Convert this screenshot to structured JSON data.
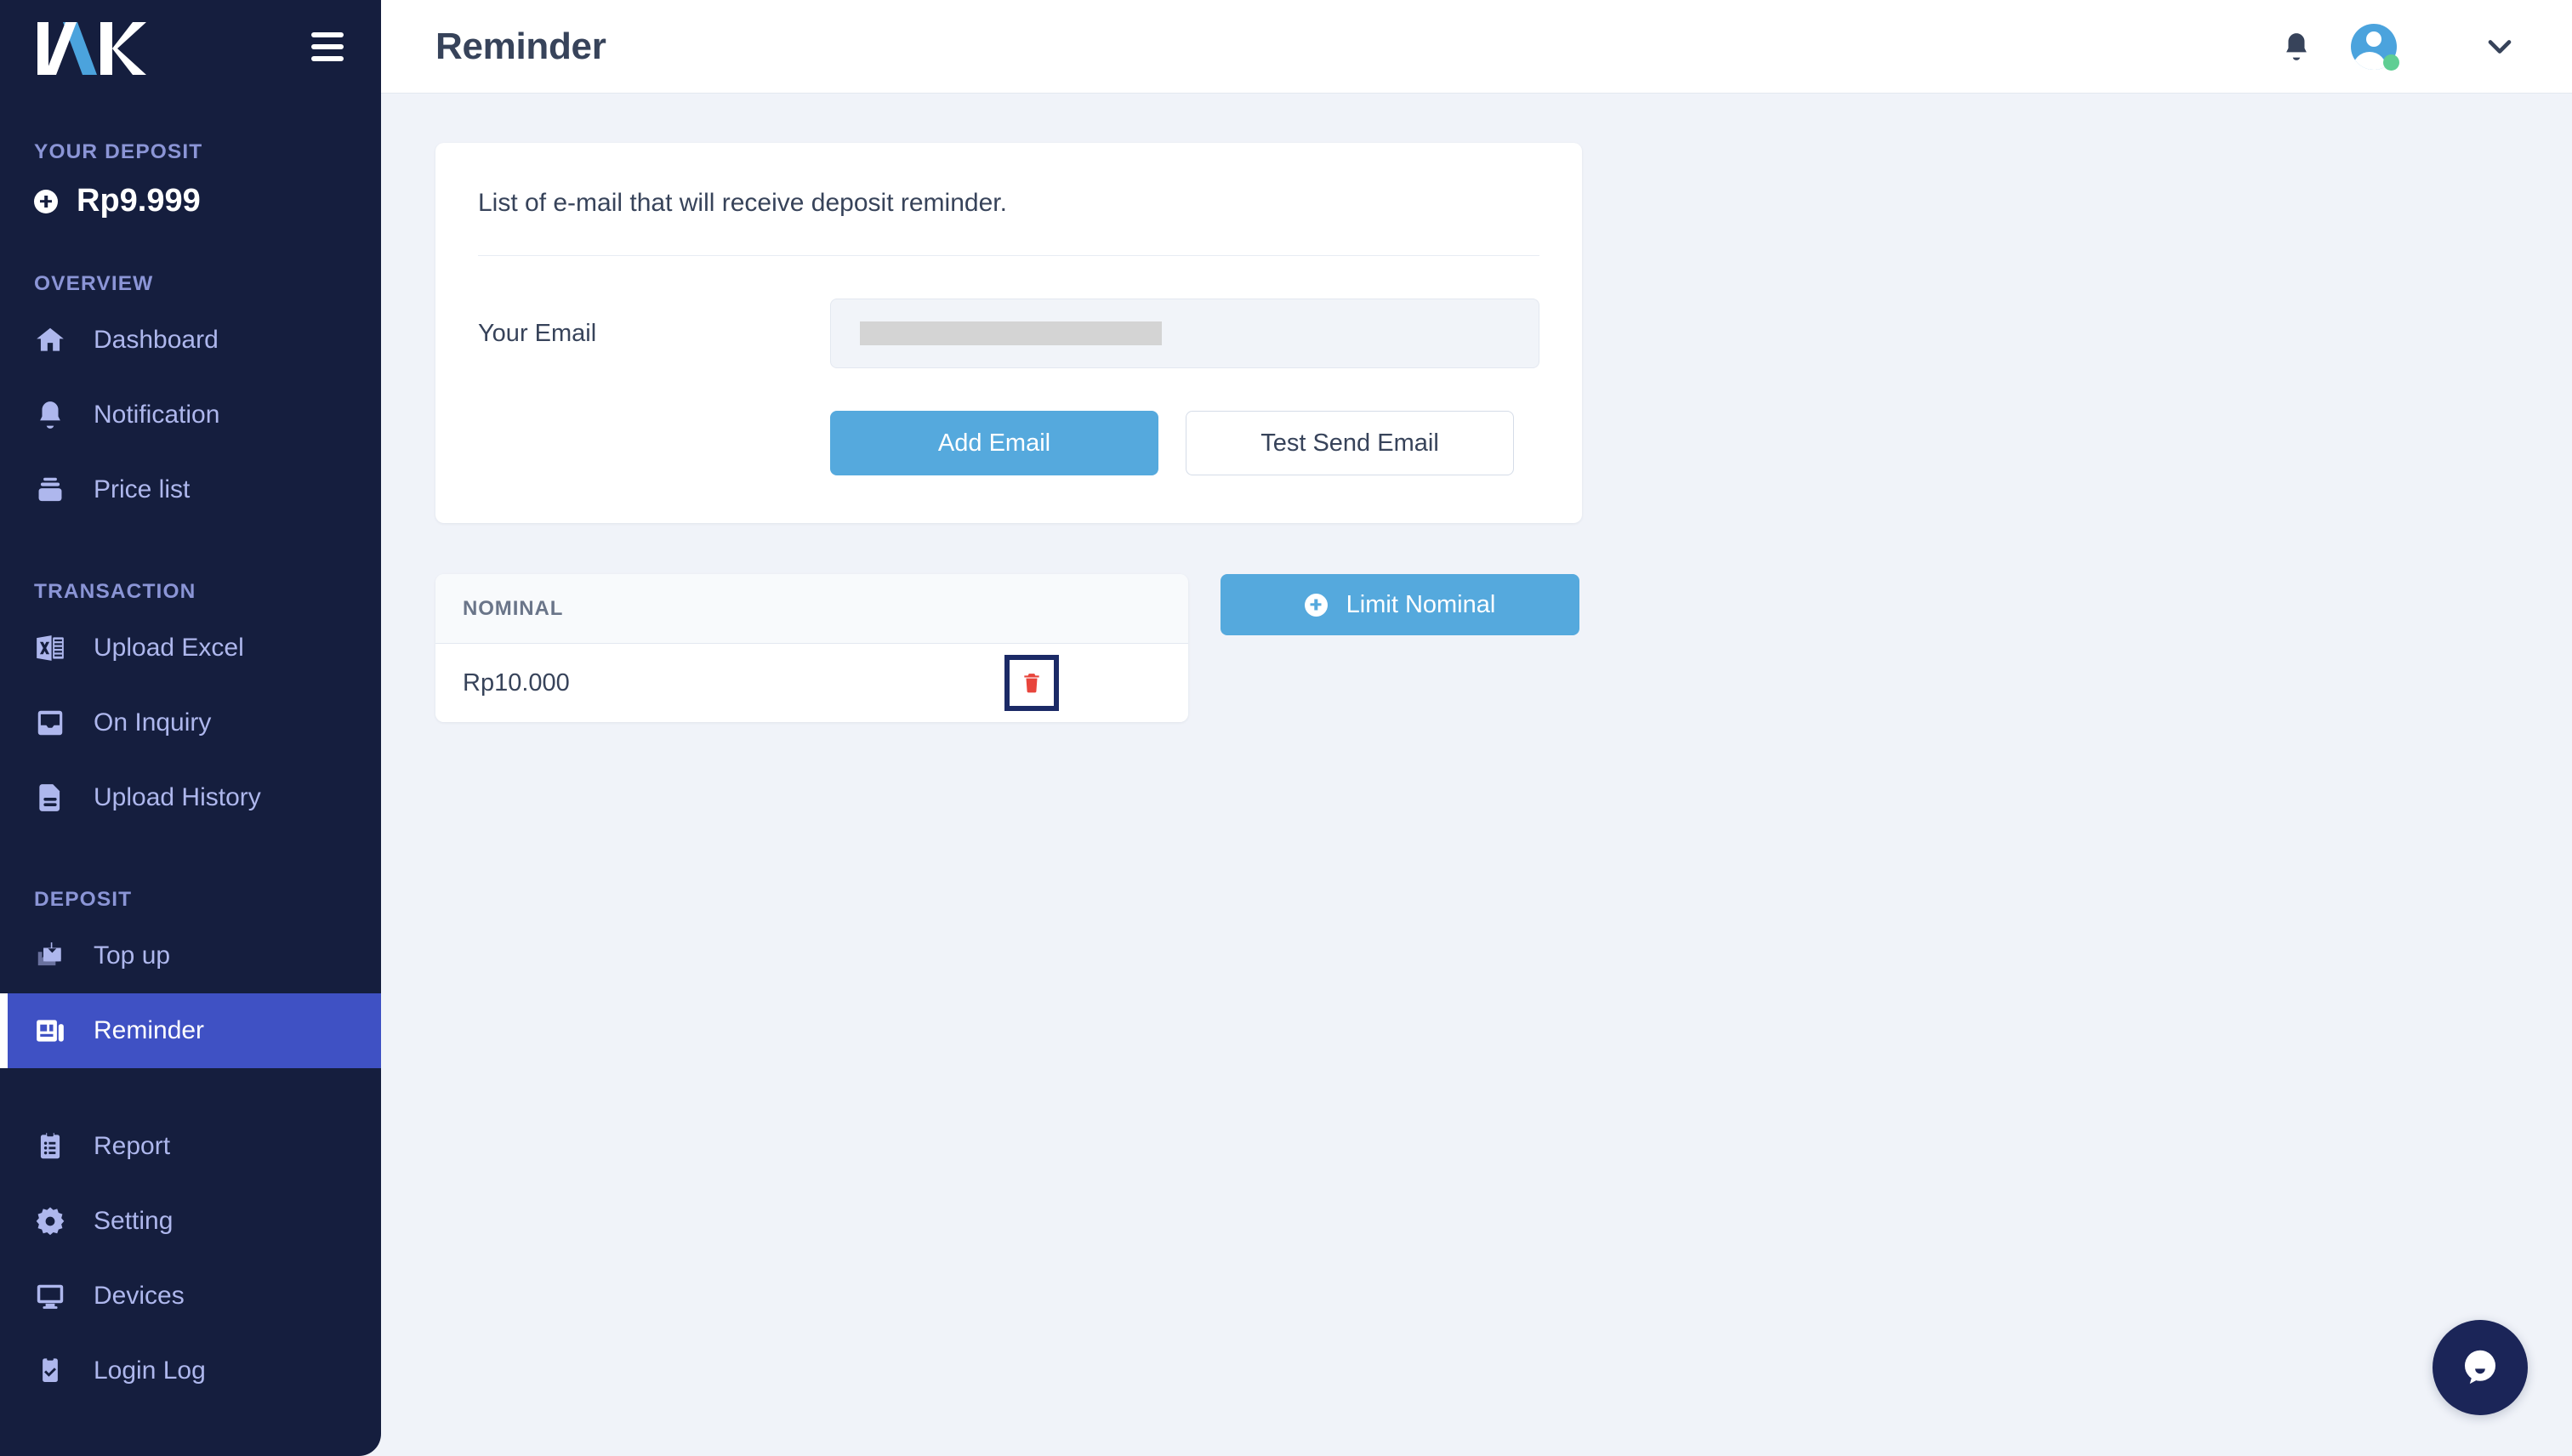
{
  "brand": {
    "logo_text": "IAK"
  },
  "sidebar": {
    "deposit_section_label": "YOUR DEPOSIT",
    "deposit_amount": "Rp9.999",
    "groups": [
      {
        "label": "OVERVIEW",
        "items": [
          {
            "label": "Dashboard",
            "icon": "home-icon",
            "active": false
          },
          {
            "label": "Notification",
            "icon": "bell-icon",
            "active": false
          },
          {
            "label": "Price list",
            "icon": "price-list-icon",
            "active": false
          }
        ]
      },
      {
        "label": "TRANSACTION",
        "items": [
          {
            "label": "Upload Excel",
            "icon": "excel-icon",
            "active": false
          },
          {
            "label": "On Inquiry",
            "icon": "inbox-icon",
            "active": false
          },
          {
            "label": "Upload History",
            "icon": "document-icon",
            "active": false
          }
        ]
      },
      {
        "label": "DEPOSIT",
        "items": [
          {
            "label": "Top up",
            "icon": "topup-icon",
            "active": false
          },
          {
            "label": "Reminder",
            "icon": "reminder-icon",
            "active": true
          }
        ]
      },
      {
        "label": "",
        "items": [
          {
            "label": "Report",
            "icon": "clipboard-list-icon",
            "active": false
          },
          {
            "label": "Setting",
            "icon": "gear-icon",
            "active": false
          },
          {
            "label": "Devices",
            "icon": "monitor-icon",
            "active": false
          },
          {
            "label": "Login Log",
            "icon": "clipboard-check-icon",
            "active": false
          }
        ]
      }
    ]
  },
  "header": {
    "title": "Reminder",
    "bell_icon": "bell-icon",
    "avatar_icon": "avatar",
    "status": "online",
    "chevron_icon": "chevron-down-icon"
  },
  "email_card": {
    "title": "List of e-mail that will receive deposit reminder.",
    "field_label": "Your Email",
    "field_value": "",
    "field_placeholder": "",
    "add_button": "Add Email",
    "test_button": "Test Send Email"
  },
  "nominal_table": {
    "columns": [
      "NOMINAL"
    ],
    "rows": [
      {
        "nominal": "Rp10.000",
        "delete_icon": "trash-icon"
      }
    ],
    "limit_button": "Limit Nominal"
  },
  "chat": {
    "icon": "chat-bubble-icon"
  },
  "colors": {
    "sidebar_bg": "#151e3e",
    "sidebar_active": "#3f51c4",
    "page_bg": "#f0f3f9",
    "primary": "#55a9dd",
    "text_dark": "#37435a",
    "danger": "#e8453c",
    "highlight_border": "#1b2a66",
    "status_green": "#5fce93"
  }
}
